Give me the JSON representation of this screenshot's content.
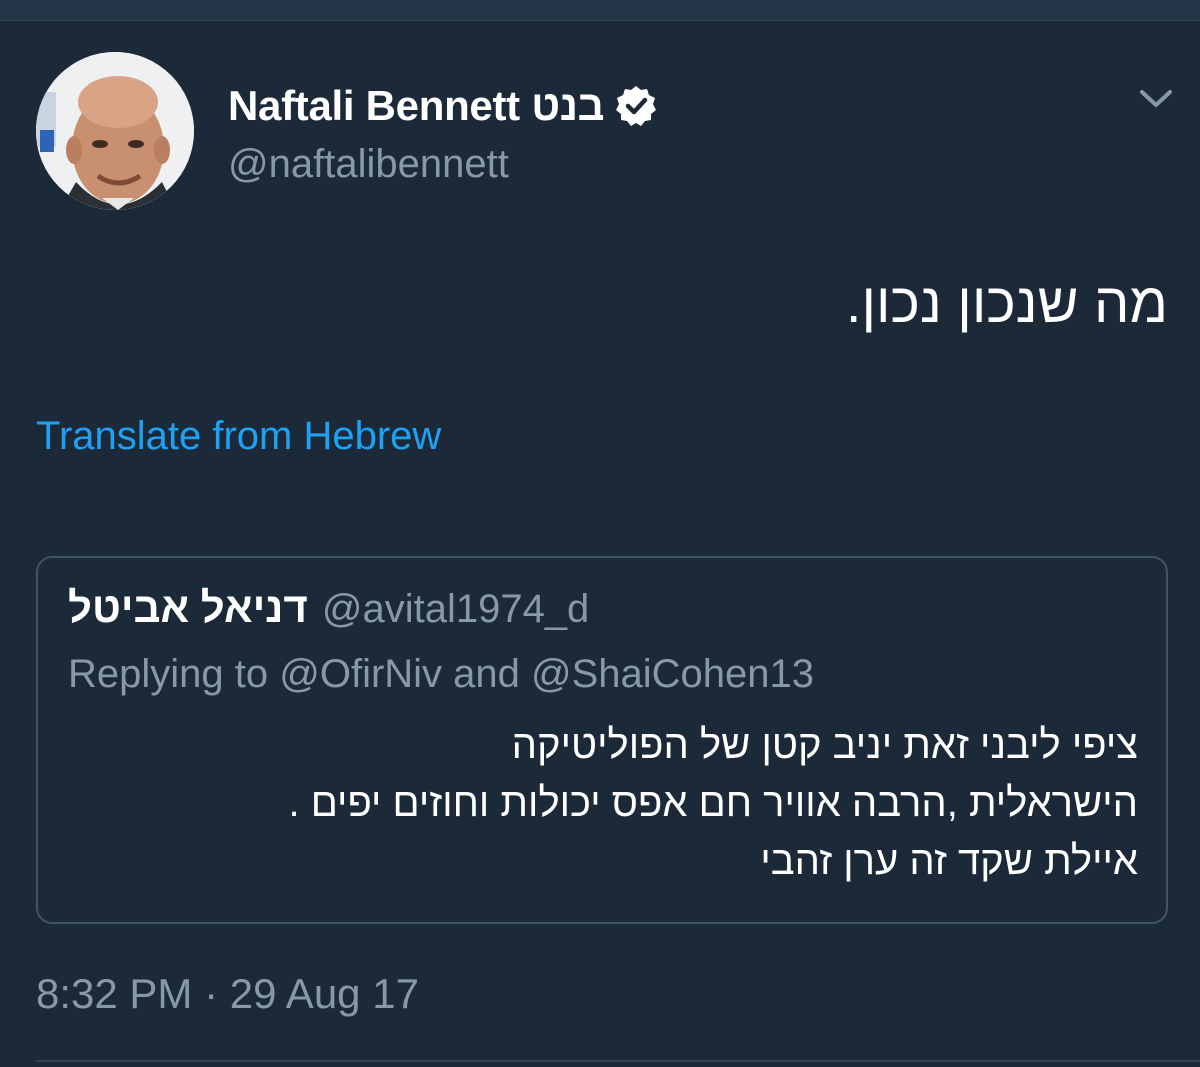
{
  "tweet": {
    "author": {
      "display_name": "Naftali Bennett בנט",
      "handle": "@naftalibennett",
      "verified": true,
      "avatar_icon": "profile-photo"
    },
    "text": "מה שנכון נכון.",
    "translate_label": "Translate from Hebrew",
    "timestamp": "8:32 PM · 29 Aug 17",
    "menu_icon": "chevron-down-icon"
  },
  "quoted_tweet": {
    "display_name": "דניאל אביטל",
    "handle": "@avital1974_d",
    "replying_to": "Replying to @OfirNiv and @ShaiCohen13",
    "lines": [
      "ציפי ליבני זאת יניב קטן של הפוליטיקה",
      "הישראלית ,הרבה אוויר חם אפס יכולות וחוזים יפים .",
      "איילת שקד זה ערן זהבי"
    ]
  },
  "colors": {
    "background": "#1c2938",
    "accent": "#1da1f2",
    "secondary_text": "#8899a6",
    "border": "#3d5466"
  }
}
